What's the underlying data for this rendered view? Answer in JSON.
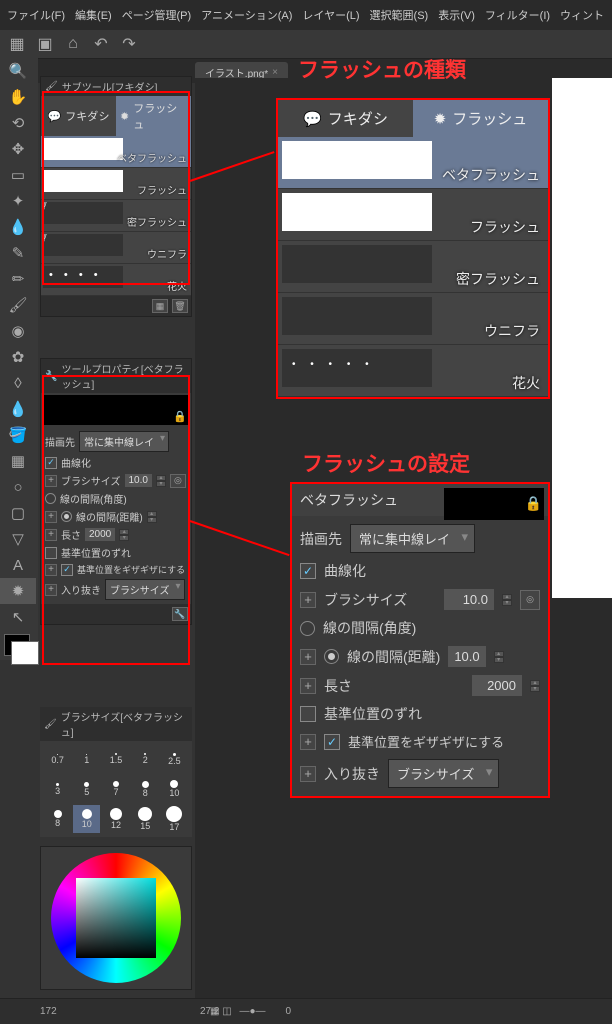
{
  "menu": [
    "ファイル(F)",
    "編集(E)",
    "ページ管理(P)",
    "アニメーション(A)",
    "レイヤー(L)",
    "選択範囲(S)",
    "表示(V)",
    "フィルター(I)",
    "ウィント"
  ],
  "tab": {
    "label": "イラスト.png*",
    "close": "×"
  },
  "subtool": {
    "title": "サブツール[フキダシ]",
    "tabs": [
      {
        "label": "フキダシ",
        "icon": "speech"
      },
      {
        "label": "フラッシュ",
        "icon": "burst",
        "active": true
      }
    ],
    "items": [
      {
        "label": "ベタフラッシュ",
        "selected": true,
        "preview": "white"
      },
      {
        "label": "フラッシュ",
        "preview": "white"
      },
      {
        "label": "密フラッシュ",
        "preview": "rays"
      },
      {
        "label": "ウニフラ",
        "preview": "rays"
      },
      {
        "label": "花火",
        "preview": "dots"
      }
    ]
  },
  "properties": {
    "title": "ツールプロパティ[ベタフラッシュ]",
    "rows": {
      "draw_dest_label": "描画先",
      "draw_dest_value": "常に集中線レイ",
      "curve_label": "曲線化",
      "brush_size_label": "ブラシサイズ",
      "brush_size_value": "10.0",
      "gap_angle_label": "線の間隔(角度)",
      "gap_dist_label": "線の間隔(距離)",
      "gap_dist_value": "10.0",
      "length_label": "長さ",
      "length_value": "2000",
      "offset_label": "基準位置のずれ",
      "jagged_label": "基準位置をギザギザにする",
      "inout_label": "入り抜き",
      "inout_value": "ブラシサイズ"
    }
  },
  "size_panel": {
    "title": "ブラシサイズ[ベタフラッシュ]",
    "row1": [
      "0.7",
      "1",
      "1.5",
      "2",
      "2.5"
    ],
    "row2": [
      "3",
      "5",
      "7",
      "8",
      "10"
    ],
    "row3": [
      8,
      10,
      12,
      15,
      17
    ],
    "selected": 1
  },
  "status": {
    "zoom": "27.2",
    "angle": "0",
    "page": "172"
  },
  "annotations": {
    "title1": "フラッシュの種類",
    "title2": "フラッシュの設定"
  },
  "enlarged_subtool": {
    "tabs": [
      {
        "label": "フキダシ"
      },
      {
        "label": "フラッシュ",
        "active": true
      }
    ],
    "items": [
      {
        "label": "ベタフラッシュ",
        "selected": true,
        "preview": "white"
      },
      {
        "label": "フラッシュ",
        "preview": "white"
      },
      {
        "label": "密フラッシュ",
        "preview": "rays"
      },
      {
        "label": "ウニフラ",
        "preview": "rays"
      },
      {
        "label": "花火",
        "preview": "dots"
      }
    ]
  },
  "enlarged_props": {
    "header": "ベタフラッシュ",
    "draw_dest_label": "描画先",
    "draw_dest_value": "常に集中線レイ",
    "curve_label": "曲線化",
    "brush_size_label": "ブラシサイズ",
    "brush_size_value": "10.0",
    "gap_angle_label": "線の間隔(角度)",
    "gap_dist_label": "線の間隔(距離)",
    "gap_dist_value": "10.0",
    "length_label": "長さ",
    "length_value": "2000",
    "offset_label": "基準位置のずれ",
    "jagged_label": "基準位置をギザギザにする",
    "inout_label": "入り抜き",
    "inout_value": "ブラシサイズ"
  }
}
